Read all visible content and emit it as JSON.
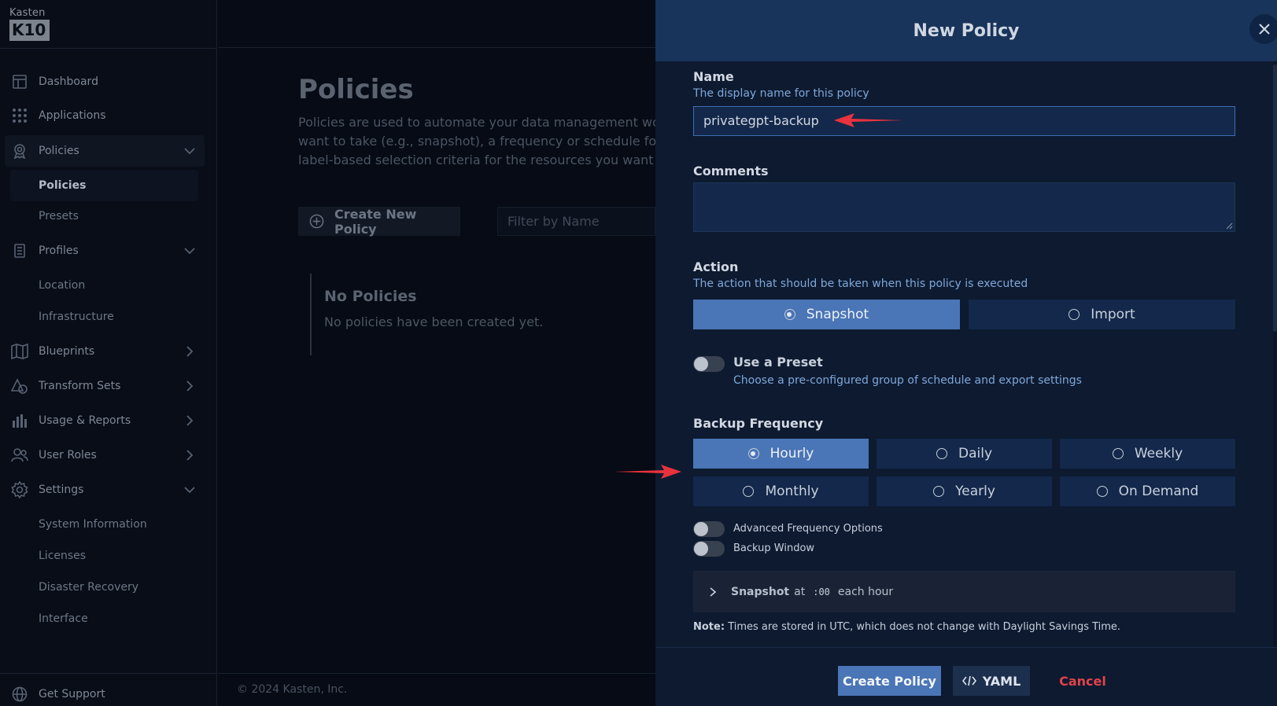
{
  "sidebar": {
    "logo_top": "Kasten",
    "logo_bottom": "K10",
    "items": [
      {
        "label": "Dashboard",
        "icon": "dashboard-icon"
      },
      {
        "label": "Applications",
        "icon": "grid-dots-icon"
      },
      {
        "label": "Policies",
        "icon": "award-icon"
      },
      {
        "label": "Profiles",
        "icon": "document-icon"
      },
      {
        "label": "Blueprints",
        "icon": "map-icon"
      },
      {
        "label": "Transform Sets",
        "icon": "shapes-icon"
      },
      {
        "label": "Usage & Reports",
        "icon": "bar-chart-icon"
      },
      {
        "label": "User Roles",
        "icon": "users-icon"
      },
      {
        "label": "Settings",
        "icon": "gear-icon"
      }
    ],
    "policies_sub": [
      "Policies",
      "Presets"
    ],
    "profiles_sub": [
      "Location",
      "Infrastructure"
    ],
    "settings_sub": [
      "System Information",
      "Licenses",
      "Disaster Recovery",
      "Interface"
    ],
    "support": "Get Support"
  },
  "main": {
    "title": "Policies",
    "desc_lines": [
      "Policies are used to automate your data management workflo",
      "want to take (e.g., snapshot), a frequency or schedule for how",
      "label-based selection criteria for the resources you want to m"
    ],
    "create_button": "Create New Policy",
    "filter_placeholder": "Filter by Name",
    "empty_title": "No Policies",
    "empty_desc": "No policies have been created yet.",
    "footer": "© 2024 Kasten, Inc."
  },
  "modal": {
    "title": "New Policy",
    "name_label": "Name",
    "name_help": "The display name for this policy",
    "name_value": "privategpt-backup",
    "comments_label": "Comments",
    "action_label": "Action",
    "action_help": "The action that should be taken when this policy is executed",
    "actions": [
      "Snapshot",
      "Import"
    ],
    "action_selected": "Snapshot",
    "preset_label": "Use a Preset",
    "preset_help": "Choose a pre-configured group of schedule and export settings",
    "frequency_label": "Backup Frequency",
    "frequencies": [
      "Hourly",
      "Daily",
      "Weekly",
      "Monthly",
      "Yearly",
      "On Demand"
    ],
    "frequency_selected": "Hourly",
    "adv_freq_label": "Advanced Frequency Options",
    "backup_window_label": "Backup Window",
    "schedule_snapshot": "Snapshot",
    "schedule_at": "at",
    "schedule_minute": ":00",
    "schedule_each": "each hour",
    "note_bold": "Note:",
    "note_text": "Times are stored in UTC, which does not change with Daylight Savings Time.",
    "create_button": "Create Policy",
    "yaml_button": "YAML",
    "cancel_button": "Cancel"
  },
  "colors": {
    "accent": "#4a75b6",
    "modal_bg": "#0d1a30",
    "cancel": "#e2424a",
    "annotation_arrow": "#e8323e"
  }
}
